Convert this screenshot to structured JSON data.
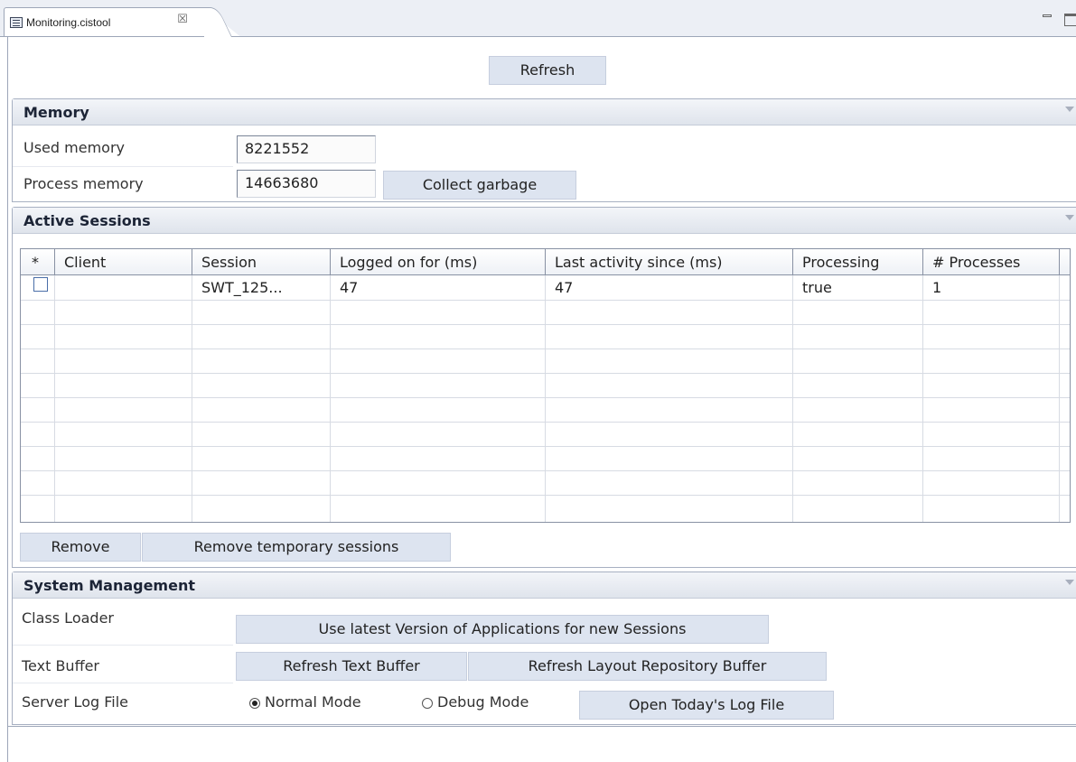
{
  "tab": {
    "title": "Monitoring.cistool",
    "close_glyph": "☒"
  },
  "toolbar": {
    "refresh_label": "Refresh"
  },
  "memory": {
    "title": "Memory",
    "used_label": "Used memory",
    "used_value": "8221552",
    "process_label": "Process memory",
    "process_value": "14663680",
    "gc_label": "Collect garbage"
  },
  "sessions": {
    "title": "Active Sessions",
    "columns": [
      "*",
      "Client",
      "Session",
      "Logged on for (ms)",
      "Last activity since (ms)",
      "Processing",
      "# Processes"
    ],
    "rows": [
      {
        "checked": false,
        "client": "",
        "session": "SWT_125...",
        "logged_on": "47",
        "last_activity": "47",
        "processing": "true",
        "processes": "1"
      }
    ],
    "remove_label": "Remove",
    "remove_temp_label": "Remove temporary sessions"
  },
  "system": {
    "title": "System Management",
    "class_loader_label": "Class Loader",
    "class_loader_button": "Use latest Version of Applications for new Sessions",
    "text_buffer_label": "Text Buffer",
    "refresh_text_button": "Refresh Text Buffer",
    "refresh_layout_button": "Refresh Layout Repository Buffer",
    "log_label": "Server Log File",
    "normal_mode": "Normal Mode",
    "debug_mode": "Debug Mode",
    "selected_mode": "Normal Mode",
    "open_log_button": "Open Today's Log File"
  },
  "icons": {
    "tab_icon": "editor-icon",
    "minimize": "minimize-icon",
    "maximize": "maximize-icon",
    "collapse": "chevron-down-icon"
  },
  "colors": {
    "button_bg": "#dde4f0",
    "section_header": "#e6eaf0",
    "border": "#9da6b8"
  }
}
